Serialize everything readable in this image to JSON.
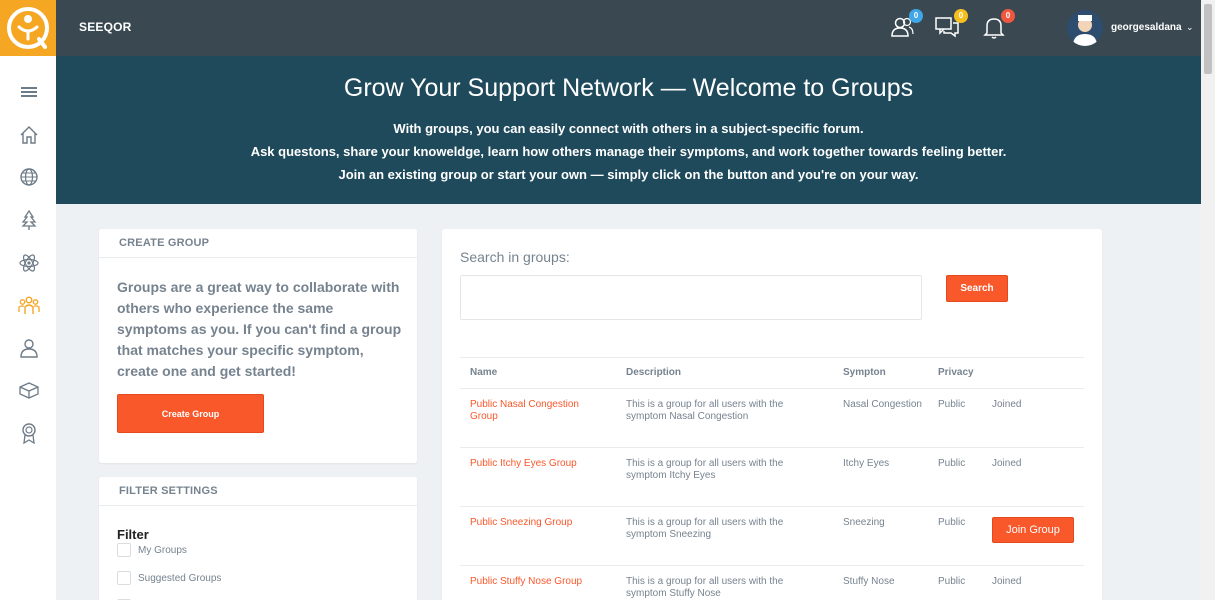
{
  "brand": "SEEQOR",
  "header": {
    "badges": {
      "connections": "0",
      "messages": "0",
      "notifications": "0"
    },
    "username": "georgesaldana",
    "user_chevron": "⌄"
  },
  "sidebar": {
    "items": [
      "menu-icon",
      "home-icon",
      "globe-icon",
      "tree-icon",
      "atom-icon",
      "groups-icon",
      "profile-icon",
      "box-icon",
      "award-icon"
    ]
  },
  "hero": {
    "title": "Grow Your Support Network — Welcome to Groups",
    "line1": "With groups, you can easily connect with others in a subject-specific forum.",
    "line2": "Ask questons, share your knoweldge, learn how others manage their symptoms, and work together towards feeling better.",
    "line3": "Join an existing group or start your own — simply click on the button and you're on your way."
  },
  "create_group": {
    "header": "CREATE GROUP",
    "description": "Groups are a great way to collaborate with others who experience the same symptoms as you. If you can't find a group that matches your specific symptom, create one and get started!",
    "button": "Create Group"
  },
  "filter": {
    "header": "FILTER SETTINGS",
    "title": "Filter",
    "options": [
      "My Groups",
      "Suggested Groups"
    ]
  },
  "search": {
    "label": "Search in groups:",
    "value": "",
    "button": "Search"
  },
  "table": {
    "columns": [
      "Name",
      "Description",
      "Sympton",
      "Privacy"
    ],
    "rows": [
      {
        "name": "Public Nasal Congestion Group",
        "description": "This is a group for all users with the symptom Nasal Congestion",
        "symptom": "Nasal Congestion",
        "privacy": "Public",
        "action": "Joined"
      },
      {
        "name": "Public Itchy Eyes Group",
        "description": "This is a group for all users with the symptom Itchy Eyes",
        "symptom": "Itchy Eyes",
        "privacy": "Public",
        "action": "Joined"
      },
      {
        "name": "Public Sneezing Group",
        "description": "This is a group for all users with the symptom Sneezing",
        "symptom": "Sneezing",
        "privacy": "Public",
        "action": "Join Group"
      },
      {
        "name": "Public Stuffy Nose Group",
        "description": "This is a group for all users with the symptom Stuffy Nose",
        "symptom": "Stuffy Nose",
        "privacy": "Public",
        "action": "Joined"
      }
    ]
  },
  "colors": {
    "accent": "#f9582b",
    "topbar": "#3a4851",
    "hero": "#1f4a5c",
    "logo": "#f5a623"
  }
}
